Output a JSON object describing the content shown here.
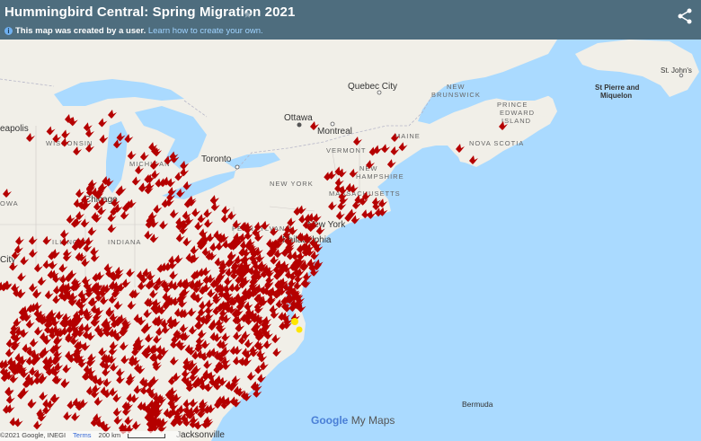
{
  "header": {
    "title": "Hummingbird Central: Spring Migration 2021",
    "subtitle_text": "This map was created by a user.",
    "subtitle_link": "Learn how to create your own."
  },
  "map_labels": {
    "quebec_city": "Quebec City",
    "ottawa": "Ottawa",
    "montreal": "Montreal",
    "toronto": "Toronto",
    "new_brunswick_1": "NEW",
    "new_brunswick_2": "BRUNSWICK",
    "pei_1": "PRINCE",
    "pei_2": "EDWARD",
    "pei_3": "ISLAND",
    "nova_scotia": "NOVA SCOTIA",
    "maine": "MAINE",
    "vermont": "VERMONT",
    "new_hampshire_1": "NEW",
    "new_hampshire_2": "HAMPSHIRE",
    "massachusetts": "MASSACHUSETTS",
    "new_york_state": "NEW YORK",
    "new_york_city": "New York",
    "philadelphia": "Philadelphia",
    "pennsylvania": "PENNSYLVANIA",
    "wisconsin": "WISCONSIN",
    "michigan": "MICHIGAN",
    "chicago": "Chicago",
    "illinois": "ILLINOIS",
    "indiana": "INDIANA",
    "iowa": "OWA",
    "minneapolis": "eapolis",
    "city": "City",
    "st_pierre_1": "St Pierre and",
    "st_pierre_2": "Miquelon",
    "st_johns": "St. John's",
    "bermuda": "Bermuda",
    "jacksonville": "Jacksonville"
  },
  "footer": {
    "attribution": "©2021 Google, INEGI",
    "terms": "Terms",
    "scale": "200 km"
  },
  "brand": {
    "google": "Google",
    "mymaps": "My Maps"
  },
  "colors": {
    "header_bg": "#4e6d7e",
    "water": "#aadaff",
    "land": "#f1efe8",
    "marker": "#b50000"
  }
}
